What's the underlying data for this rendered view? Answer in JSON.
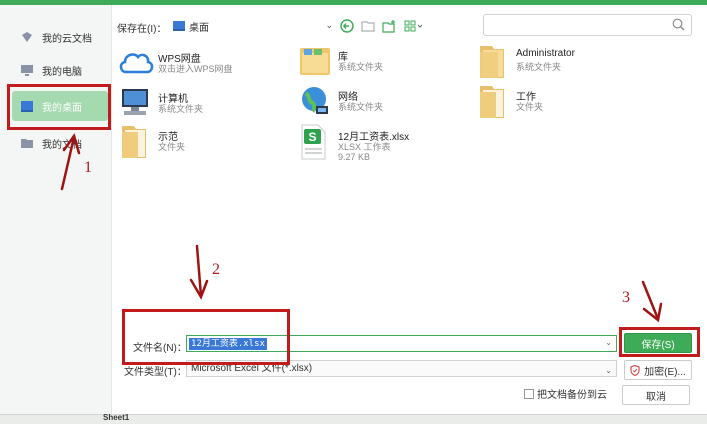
{
  "sidebar": {
    "items": [
      {
        "label": "我的云文档",
        "icon": "cloud-doc-icon",
        "active": false
      },
      {
        "label": "我的电脑",
        "icon": "computer-icon",
        "active": false
      },
      {
        "label": "我的桌面",
        "icon": "desktop-icon",
        "active": true
      },
      {
        "label": "我的文档",
        "icon": "folder-icon",
        "active": false
      }
    ]
  },
  "toolbar": {
    "save_in_label": "保存在(I)：",
    "location": "桌面",
    "buttons": [
      "back-icon",
      "up-folder-icon",
      "new-folder-icon",
      "view-mode-icon"
    ]
  },
  "search": {
    "placeholder": ""
  },
  "files": [
    {
      "name": "WPS网盘",
      "sub": "双击进入WPS网盘",
      "size": "",
      "icon": "wps-cloud-icon"
    },
    {
      "name": "库",
      "sub": "系统文件夹",
      "size": "",
      "icon": "library-icon"
    },
    {
      "name": "Administrator",
      "sub": "系统文件夹",
      "size": "",
      "icon": "user-folder-icon"
    },
    {
      "name": "计算机",
      "sub": "系统文件夹",
      "size": "",
      "icon": "computer-icon"
    },
    {
      "name": "网络",
      "sub": "系统文件夹",
      "size": "",
      "icon": "network-icon"
    },
    {
      "name": "工作",
      "sub": "文件夹",
      "size": "",
      "icon": "folder-icon"
    },
    {
      "name": "示范",
      "sub": "文件夹",
      "size": "",
      "icon": "folder-icon"
    },
    {
      "name": "12月工资表.xlsx",
      "sub": "XLSX 工作表",
      "size": "9.27 KB",
      "icon": "xlsx-file-icon"
    }
  ],
  "form": {
    "filename_label": "文件名(N)：",
    "filename_value": "12月工资表.xlsx",
    "filetype_label": "文件类型(T)：",
    "filetype_value": "Microsoft Excel 文件(*.xlsx)",
    "save_button": "保存(S)",
    "encrypt_button": "加密(E)...",
    "cancel_button": "取消",
    "backup_label": "把文档备份到云"
  },
  "sheet": {
    "tab": "Sheet1"
  },
  "annotations": {
    "n1": "1",
    "n2": "2",
    "n3": "3"
  },
  "colors": {
    "accent": "#3dab58",
    "highlight": "#c11b1b",
    "selection": "#3a78d6"
  }
}
